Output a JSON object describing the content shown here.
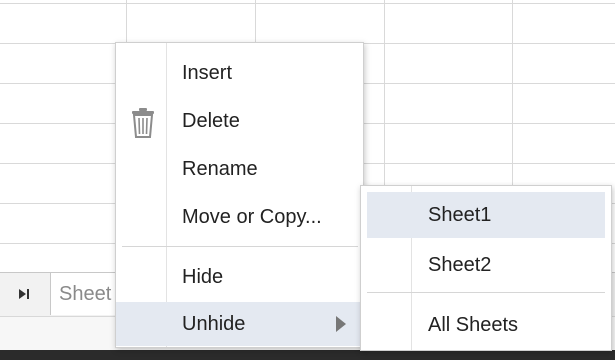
{
  "sheet_tabs": {
    "nav_last_glyph": "⏭",
    "active_tab_label": "Sheet"
  },
  "context_menu": {
    "items": [
      {
        "label": "Insert"
      },
      {
        "label": "Delete",
        "icon": "trash-icon"
      },
      {
        "label": "Rename"
      },
      {
        "label": "Move or Copy..."
      },
      {
        "label": "Hide"
      },
      {
        "label": "Unhide",
        "has_submenu": true,
        "highlighted": true
      }
    ]
  },
  "unhide_submenu": {
    "items": [
      {
        "label": "Sheet1",
        "highlighted": true
      },
      {
        "label": "Sheet2"
      },
      {
        "label": "All Sheets"
      }
    ]
  },
  "colors": {
    "highlight": "#e4e9f1",
    "grid_line": "#d9d9d9",
    "tab_bar": "#f2f2f2"
  }
}
